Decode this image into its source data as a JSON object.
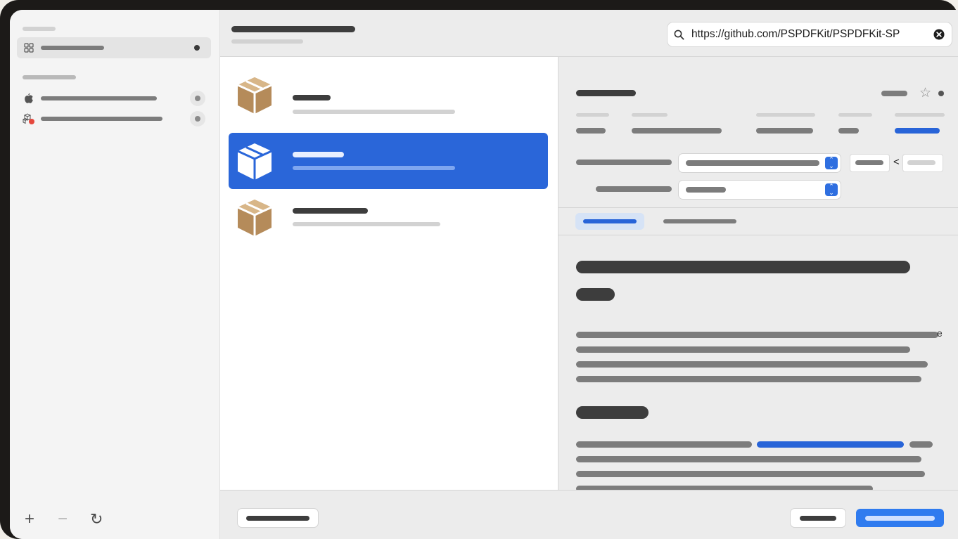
{
  "search": {
    "value": "https://github.com/PSPDFKit/PSPDFKit-SP"
  },
  "detail": {
    "overflow_char": "e",
    "version_compare": "<"
  },
  "sidebar": {
    "footer": {
      "add_glyph": "+",
      "remove_glyph": "−",
      "refresh_glyph": "↻"
    }
  },
  "icons": {
    "search": "magnifying-glass",
    "clear": "x-circle-fill",
    "star": "☆",
    "package": "cardboard-box",
    "grid": "grid-2x2",
    "apple": "apple-logo",
    "package_error": "package-with-error-badge"
  },
  "colors": {
    "accent": "#2864d8",
    "package_brown": "#b58b5a",
    "error_badge": "#e5483d"
  }
}
